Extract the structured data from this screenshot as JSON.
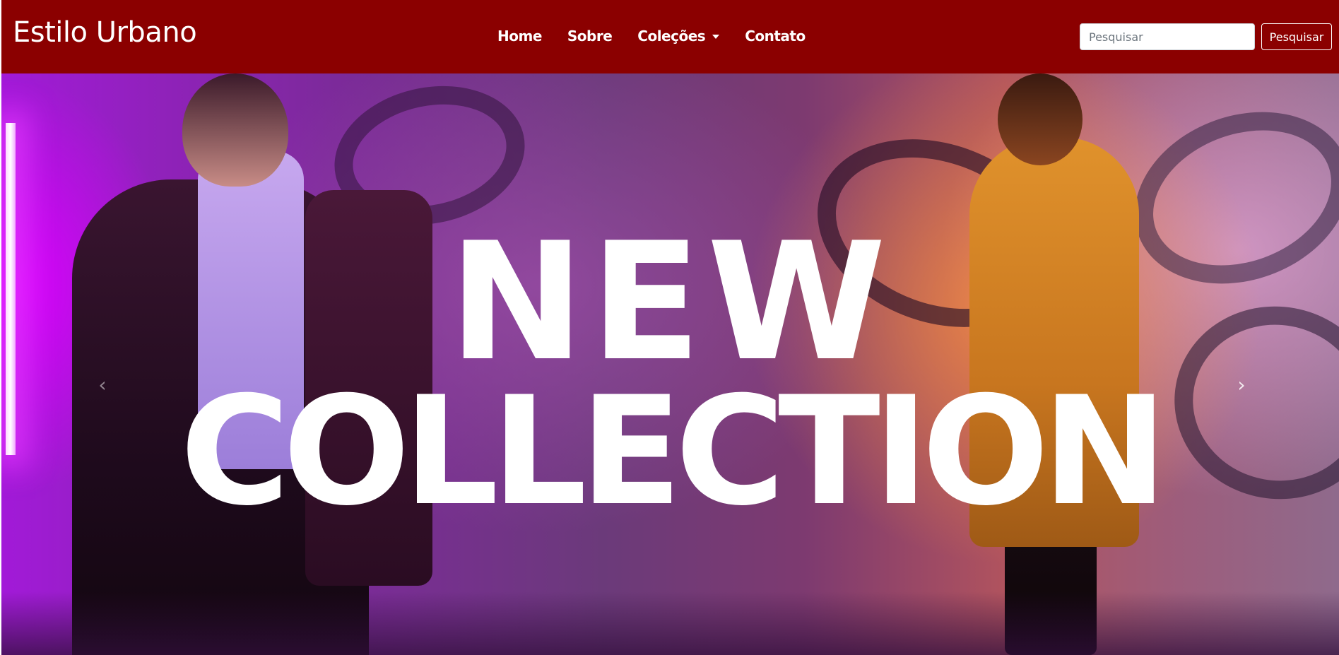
{
  "navbar": {
    "brand": "Estilo Urbano",
    "background_color": "#8b0000",
    "links": [
      {
        "label": "Home"
      },
      {
        "label": "Sobre"
      },
      {
        "label": "Coleções",
        "has_dropdown": true
      },
      {
        "label": "Contato"
      }
    ],
    "search": {
      "placeholder": "Pesquisar",
      "value": "",
      "button_label": "Pesquisar"
    }
  },
  "hero": {
    "line1": "NEW",
    "line2": "COLLECTION",
    "prev_icon": "chevron-left-icon",
    "next_icon": "chevron-right-icon",
    "prev_glyph": "‹",
    "next_glyph": "›"
  }
}
